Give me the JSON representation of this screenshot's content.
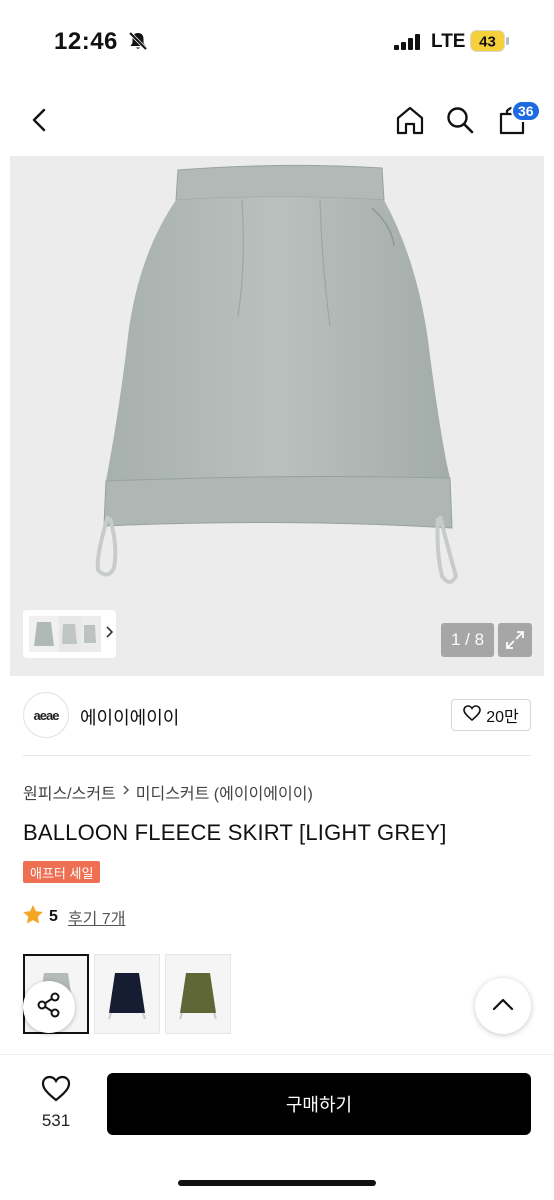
{
  "status": {
    "time": "12:46",
    "network": "LTE",
    "battery": "43",
    "icons": [
      "bell-slash-icon",
      "signal-icon",
      "battery-icon"
    ]
  },
  "header": {
    "icons": [
      "back-icon",
      "home-icon",
      "search-icon",
      "cart-icon"
    ],
    "cart_count": "36"
  },
  "gallery": {
    "pager": "1 / 8",
    "icons": [
      "chevron-right-icon",
      "expand-icon"
    ]
  },
  "brand": {
    "logo_text": "aeae",
    "name": "에이이에이이",
    "likes": "20만"
  },
  "breadcrumb": {
    "category": "원피스/스커트",
    "subcategory": "미디스커트 (에이이에이이)"
  },
  "product": {
    "title": "BALLOON FLEECE SKIRT [LIGHT GREY]",
    "tag": "애프터 세일",
    "rating": "5",
    "reviews": "후기 7개"
  },
  "color_options": [
    "light grey",
    "navy",
    "khaki"
  ],
  "colors": {
    "accent_blue": "#1e6ae1",
    "sale_tag": "#ef6f53",
    "star": "#f2a622",
    "buy_button": "#000000"
  },
  "bottom": {
    "wish_count": "531",
    "buy_label": "구매하기"
  }
}
